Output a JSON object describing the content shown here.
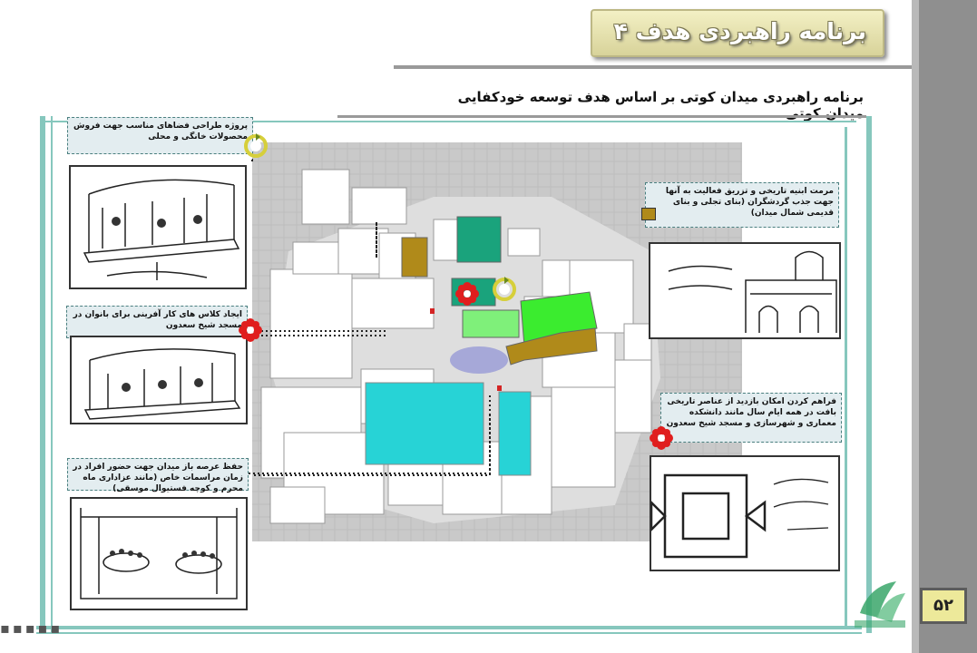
{
  "title": "برنامه راهبردی هدف ۴",
  "subtitle": "برنامه راهبردی میدان کوتی بر اساس هدف توسعه خودکفایی میدان کوتی",
  "page_number": "۵۲",
  "labels": {
    "label1": "پروژه طراحی فضاهای مناسب جهت فروش محصولات خانگی و محلی",
    "label2": "ایجاد کلاس های کار آفرینی برای بانوان در مسجد شیخ سعدون",
    "label3": "حفظ عرصه باز میدان جهت حضور افراد در زمان مراسمات خاص (مانند عزاداری ماه محرم و کوچه فستیوال موسقی)",
    "label4": "مرمت ابنیه تاریخی و تزریق فعالیت به آنها جهت جذب گردشگران (بنای تجلی و بنای قدیمی شمال میدان)",
    "label5": "فراهم کردن امکان بازدید از عناصر تاریخی بافت در همه ایام سال مانند دانشکده معماری و شهرسازی و مسجد شیخ سعدون"
  },
  "colors": {
    "teal_frame": "#86c7bd",
    "title_bg": "#ede99a",
    "cyan_zone": "#27d3d6",
    "green_zone": "#3bec2f",
    "brown_zone": "#b08a1a",
    "dark_green": "#1aa37c"
  },
  "icons": {
    "cycle": "cycle-arrows-icon",
    "rosette": "red-rosette-icon",
    "logo": "brand-logo-icon"
  },
  "dash": "▪▪▪▪▪"
}
